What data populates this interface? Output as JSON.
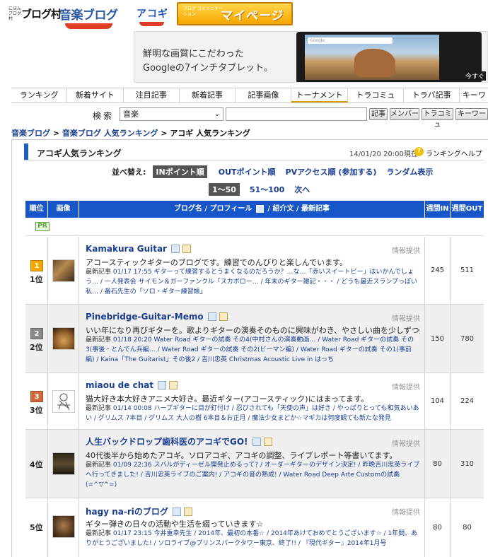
{
  "header": {
    "logo_mura_small": "にほんブログ村",
    "logo_mura_big": "ブログ村",
    "logo_ongaku": "音楽ブログ",
    "logo_acogi": "アコギ",
    "mypage_small": "ブログ コミュニケーション",
    "mypage_big": "マイページ"
  },
  "ad": {
    "line1": "鮮明な画質にこだわった",
    "line2": "Googleの7インチタブレット。",
    "search_bar": "Google",
    "cta": "今すぐ"
  },
  "nav": {
    "tabs": [
      "ランキング",
      "新着サイト",
      "注目記事",
      "新着記事",
      "記事画像",
      "トーナメント",
      "トラコミュ",
      "トラバ記事",
      "キーワ"
    ]
  },
  "search": {
    "label": "検索",
    "category": "音楽",
    "query": "",
    "buttons": [
      "記事",
      "メンバー",
      "トラコミュ",
      "キーワー"
    ]
  },
  "breadcrumb": {
    "items": [
      "音楽ブログ",
      "音楽ブログ 人気ランキング"
    ],
    "current": "アコギ 人気ランキング",
    "sep": ">"
  },
  "ranking": {
    "title": "アコギ人気ランキング",
    "date": "14/01/20 20:00現在",
    "help": "ランキングヘルプ",
    "help_icon": "?",
    "sort_label": "並べ替え:",
    "sorts": [
      "INポイント順",
      "OUTポイント順",
      "PVアクセス順 (参加する)",
      "ランダム表示"
    ],
    "pages": [
      "1〜50",
      "51〜100",
      "次へ"
    ]
  },
  "table": {
    "headers": [
      "順位",
      "画像",
      "ブログ名 / プロフィール",
      "/ 紹介文 / 最新記事",
      "週間IN",
      "週間OUT"
    ],
    "pr": "PR",
    "info_label": "情報提供",
    "recent_label": "最新記事",
    "rows": [
      {
        "rank": "1位",
        "medal": "1",
        "medal_color": "#f0a800",
        "name": "Kamakura Guitar",
        "intro": "アコースティックギターのブログです。練習でのんびりと楽しんでいます。",
        "recent": "01/17 17:55 ギターって練習するとうまくなるのだろうか？…な…「赤いスイートピー」はいかんでしょう… / 一人発表会 サイモン＆ガーファンクル「スカボロー… / 年末のギター雑記・・・ / どうも最近スランプっぽい私… / 番石先生の「ソロ・ギター練習帳」",
        "in": "245",
        "out": "511"
      },
      {
        "rank": "2位",
        "medal": "2",
        "medal_color": "#8a8a8a",
        "name": "Pinebridge-Guitar-Memo",
        "intro": "いい年になり再びギターを。歌よりギターの演奏そのものに興味がわき、やさしい曲を少しずつ楽しんでます。",
        "recent": "01/18 20:20 Water Road ギターの試奏 その4(中村さんの演奏動画… / Water Road ギターの試奏 その3(事後・とんでん兵編… / Water Road ギターの試奏 その2(ビーマン編) / Water Road ギターの試奏 その1(事前編) / Kaina「The Guitarist」その後2 / 吉川忠英 Christmas Acoustic Live in はっち",
        "in": "150",
        "out": "780"
      },
      {
        "rank": "3位",
        "medal": "3",
        "medal_color": "#d26a3a",
        "name": "miaou de chat",
        "intro": "猫大好き本大好きアニメ大好き。最近ギター(アコースティック)にはまってます。",
        "recent": "01/14 00:08 ハープギターに目が釘付け / 忍びされても「天使の声」は好き / やっぱりとっても和気あいあい / グリムス 7本目 / グリムス 大人の樹 6本目＆お正月 / 魔法少女まどか☆マギカは何度観ても新たな発見",
        "in": "104",
        "out": "224"
      },
      {
        "rank": "4位",
        "medal": "",
        "medal_color": "",
        "name": "人生バックドロップ歯科医のアコギでGO!",
        "intro": "40代後半から始めたアコギ。ソロアコギ、アコギの調整、ライブレポート等書いてます。",
        "recent": "01/09 22:36 スバルがディーゼル開発止めるって? / オーダーギターのデザイン決定! / 昨晩吉川忠英ライブへ行ってきました! / 吉川忠英ライブのご案内! / アコギの音の熟成! / Water Road Deep Arte Customの試奏(=^▽^=)",
        "in": "80",
        "out": "310"
      },
      {
        "rank": "5位",
        "medal": "",
        "medal_color": "",
        "name": "hagy na-riのブログ",
        "intro": "ギター弾きの日々の活動や生活を綴っていきます☆",
        "recent": "01/17 23:15 今井重幸先生 / 2014年、最初の本番☆ / 2014年あけておめでとうございます☆ / 1年間、ありがとうございました! / ソロライブ@プリンスパークタワー東京、終了!! / 『現代ギター』2014年1月号",
        "in": "80",
        "out": "80"
      }
    ]
  }
}
